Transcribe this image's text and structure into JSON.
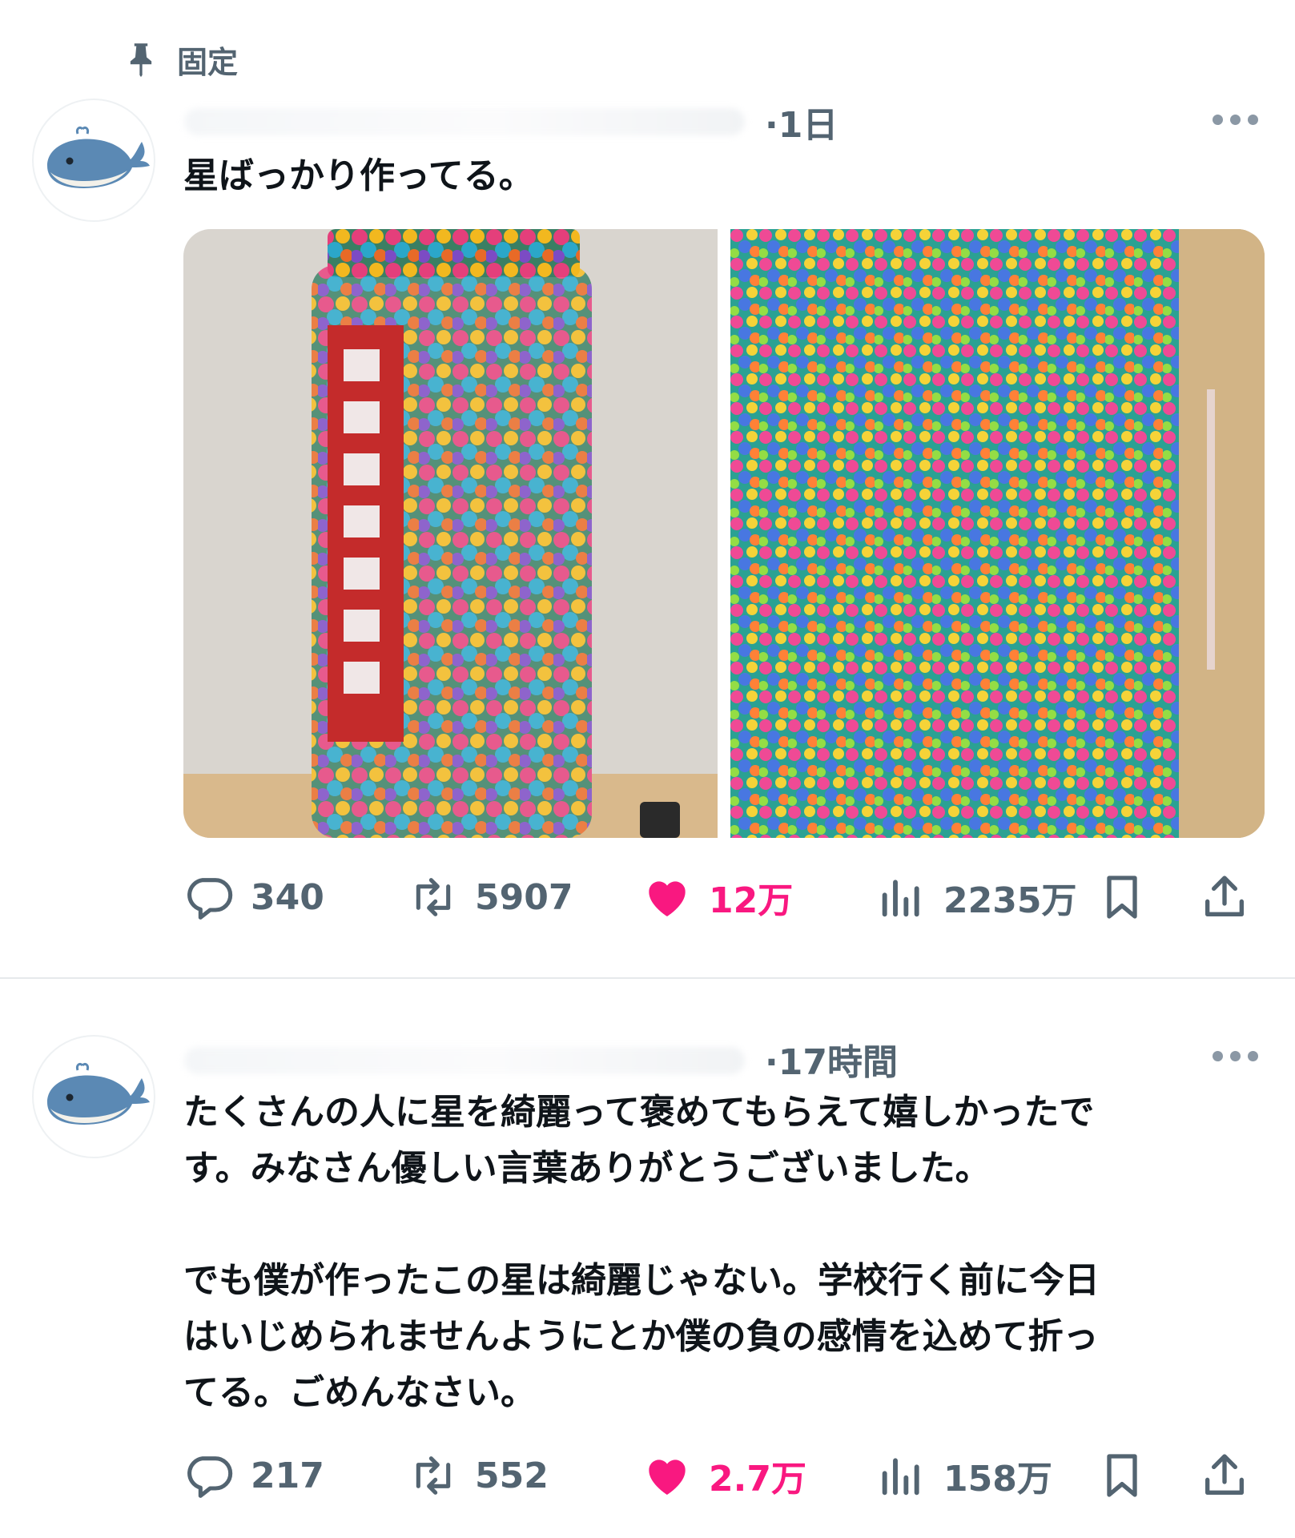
{
  "pinned": {
    "label": "固定"
  },
  "tweets": [
    {
      "time": "·1日",
      "text": "星ばっかり作ってる。",
      "stats": {
        "replies": "340",
        "retweets": "5907",
        "likes": "12万",
        "views": "2235万"
      }
    },
    {
      "time": "·17時間",
      "text": "たくさんの人に星を綺麗って褒めてもらえて嬉しかったで\nす。みなさん優しい言葉ありがとうございました。\n\nでも僕が作ったこの星は綺麗じゃない。学校行く前に今日\nはいじめられませんようにとか僕の負の感情を込めて折っ\nてる。ごめんなさい。",
      "stats": {
        "replies": "217",
        "retweets": "552",
        "likes": "2.7万",
        "views": "158万"
      }
    }
  ],
  "colors": {
    "muted": "#536471",
    "like": "#f91880",
    "divider": "#e6e9eb"
  },
  "icons": [
    "pin-icon",
    "more-icon",
    "reply-icon",
    "retweet-icon",
    "heart-icon",
    "views-icon",
    "bookmark-icon",
    "share-icon",
    "whale-avatar-icon"
  ]
}
